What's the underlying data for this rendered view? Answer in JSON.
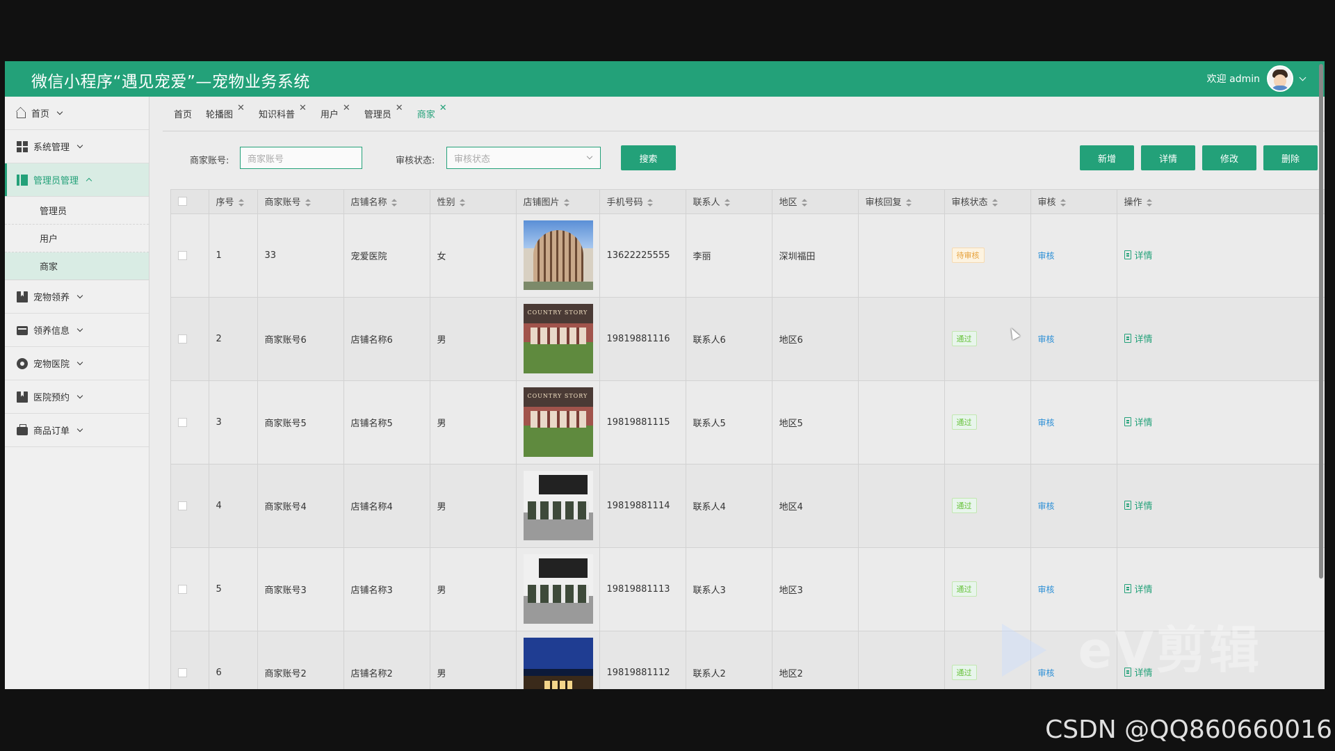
{
  "header": {
    "title": "微信小程序“遇见宠爱”—宠物业务系统",
    "welcome": "欢迎 admin"
  },
  "sidebar": {
    "items": [
      {
        "label": "首页",
        "icon": "home-icon"
      },
      {
        "label": "系统管理",
        "icon": "grid-icon"
      },
      {
        "label": "管理员管理",
        "icon": "panel-icon",
        "expanded": true
      },
      {
        "label": "宠物领养",
        "icon": "book-icon"
      },
      {
        "label": "领养信息",
        "icon": "card-icon"
      },
      {
        "label": "宠物医院",
        "icon": "circle-icon"
      },
      {
        "label": "医院预约",
        "icon": "book-icon"
      },
      {
        "label": "商品订单",
        "icon": "bag-icon"
      }
    ],
    "sub_items": [
      "管理员",
      "用户",
      "商家"
    ]
  },
  "tabs": [
    {
      "label": "首页",
      "closable": false
    },
    {
      "label": "轮播图",
      "closable": true
    },
    {
      "label": "知识科普",
      "closable": true
    },
    {
      "label": "用户",
      "closable": true
    },
    {
      "label": "管理员",
      "closable": true
    },
    {
      "label": "商家",
      "closable": true,
      "active": true
    }
  ],
  "search": {
    "account_label": "商家账号:",
    "account_placeholder": "商家账号",
    "status_label": "审核状态:",
    "status_placeholder": "审核状态",
    "search_button": "搜索"
  },
  "actions": {
    "add": "新增",
    "detail": "详情",
    "edit": "修改",
    "delete": "删除"
  },
  "table": {
    "headers": [
      "序号",
      "商家账号",
      "店铺名称",
      "性别",
      "店铺图片",
      "手机号码",
      "联系人",
      "地区",
      "审核回复",
      "审核状态",
      "审核",
      "操作"
    ],
    "rows": [
      {
        "no": "1",
        "account": "33",
        "shop": "宠爱医院",
        "gender": "女",
        "phone": "13622225555",
        "contact": "李丽",
        "region": "深圳福田",
        "reply": "",
        "status": "待审核",
        "audit": "审核",
        "op": "详情"
      },
      {
        "no": "2",
        "account": "商家账号6",
        "shop": "店铺名称6",
        "gender": "男",
        "phone": "19819881116",
        "contact": "联系人6",
        "region": "地区6",
        "reply": "",
        "status": "通过",
        "audit": "审核",
        "op": "详情"
      },
      {
        "no": "3",
        "account": "商家账号5",
        "shop": "店铺名称5",
        "gender": "男",
        "phone": "19819881115",
        "contact": "联系人5",
        "region": "地区5",
        "reply": "",
        "status": "通过",
        "audit": "审核",
        "op": "详情"
      },
      {
        "no": "4",
        "account": "商家账号4",
        "shop": "店铺名称4",
        "gender": "男",
        "phone": "19819881114",
        "contact": "联系人4",
        "region": "地区4",
        "reply": "",
        "status": "通过",
        "audit": "审核",
        "op": "详情"
      },
      {
        "no": "5",
        "account": "商家账号3",
        "shop": "店铺名称3",
        "gender": "男",
        "phone": "19819881113",
        "contact": "联系人3",
        "region": "地区3",
        "reply": "",
        "status": "通过",
        "audit": "审核",
        "op": "详情"
      },
      {
        "no": "6",
        "account": "商家账号2",
        "shop": "店铺名称2",
        "gender": "男",
        "phone": "19819881112",
        "contact": "联系人2",
        "region": "地区2",
        "reply": "",
        "status": "通过",
        "audit": "审核",
        "op": "详情"
      }
    ]
  },
  "colors": {
    "brand": "#23a179",
    "pending": "#e6a23c",
    "pass": "#67c23a",
    "link": "#2c8fd6"
  },
  "overlay": {
    "csdn": "CSDN @QQ860660016",
    "ev": "eV剪辑"
  }
}
